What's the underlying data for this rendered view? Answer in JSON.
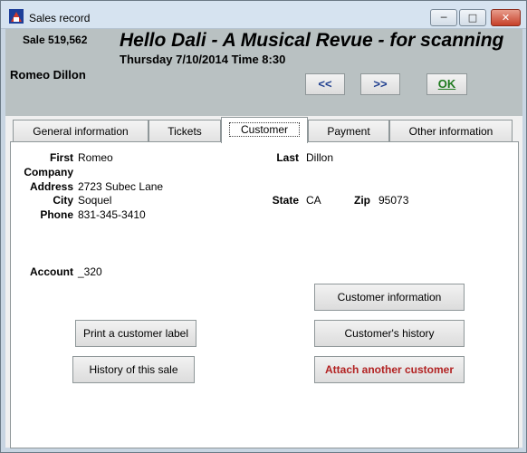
{
  "window": {
    "title": "Sales record",
    "minimize_glyph": "─",
    "maximize_glyph": "□",
    "close_glyph": "✕"
  },
  "header": {
    "sale_number": "Sale 519,562",
    "show_title": "Hello Dali - A Musical Revue - for scanning",
    "show_datetime": "Thursday 7/10/2014  Time 8:30",
    "customer_name": "Romeo Dillon",
    "prev_label": "<<",
    "next_label": ">>",
    "ok_label": "OK"
  },
  "tabs": [
    {
      "label": "General information"
    },
    {
      "label": "Tickets"
    },
    {
      "label": "Customer",
      "active": true
    },
    {
      "label": "Payment"
    },
    {
      "label": "Other information"
    }
  ],
  "customer": {
    "first_label": "First",
    "first_value": "Romeo",
    "last_label": "Last",
    "last_value": "Dillon",
    "company_label": "Company",
    "company_value": "",
    "address_label": "Address",
    "address_value": "2723 Subec Lane",
    "city_label": "City",
    "city_value": "Soquel",
    "state_label": "State",
    "state_value": "CA",
    "zip_label": "Zip",
    "zip_value": "95073",
    "phone_label": "Phone",
    "phone_value": "831-345-3410",
    "account_label": "Account",
    "account_value": "_320"
  },
  "buttons": {
    "customer_information": "Customer information",
    "print_label": "Print a customer label",
    "customer_history": "Customer's history",
    "history_of_sale": "History of this sale",
    "attach_customer": "Attach another customer"
  },
  "colors": {
    "header_bg": "#b9c1c2",
    "nav_arrow": "#1f3f8f",
    "ok_green": "#1e7a1e",
    "attach_red": "#b22222"
  }
}
